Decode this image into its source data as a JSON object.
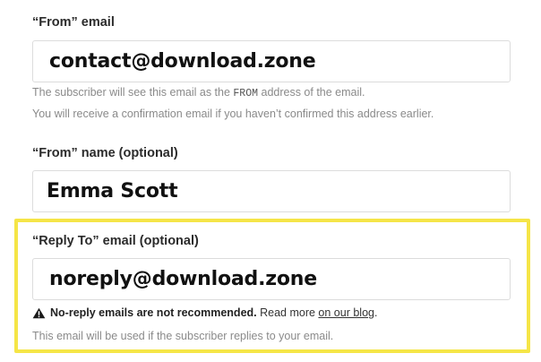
{
  "from_email": {
    "label": "“From” email",
    "value": "contact@download.zone",
    "hint_line1_pre": "The subscriber will see this email as the ",
    "hint_line1_code": "FROM",
    "hint_line1_post": " address of the email.",
    "hint_line2": "You will receive a confirmation email if you haven’t confirmed this address earlier."
  },
  "from_name": {
    "label": "“From” name (optional)",
    "value": "Emma Scott"
  },
  "reply_to": {
    "label": "“Reply To” email (optional)",
    "value": "noreply@download.zone",
    "warning_strong": "No-reply emails are not recommended.",
    "warning_text": " Read more ",
    "warning_link": "on our blog",
    "warning_end": ".",
    "hint": "This email will be used if the subscriber replies to your email."
  },
  "colors": {
    "highlight_border": "#f5e547",
    "input_border": "#dcdcdc",
    "hint_text": "#8a8a8a"
  }
}
